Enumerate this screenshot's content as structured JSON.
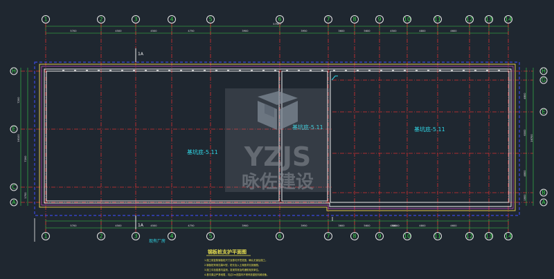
{
  "drawing": {
    "title": "钢板桩支护平面图",
    "place_label": "现有厂房",
    "section_top": "1A",
    "section_bottom": "1A",
    "level_left": "基坑底-5.11",
    "level_mid": "基坑底-5.11",
    "level_right": "基坑底-5.11",
    "total_top": "57950",
    "total_bottom": "38000",
    "notes": [
      "1.施工前复核钢板桩尺寸及基坑开挖范围，确认无误后施工。",
      "2.钢板桩采用拉森IV型，桩长及入土深度详见剖面图。",
      "3.施工中加强基坑监测，发现异常及时通知相关单位。",
      "4.基坑周边严禁堆载，坑边2m范围内不得停放重型机械设备。"
    ]
  },
  "axes_x": {
    "labels": [
      "1",
      "2",
      "3",
      "4",
      "5",
      "6",
      "7",
      "8",
      "9",
      "10",
      "11",
      "12",
      "13",
      "14"
    ],
    "spans_top": [
      "5700",
      "4500",
      "4500",
      "4750",
      "3900",
      "3950",
      "3600",
      "5600",
      "4500",
      "4800",
      "4600"
    ],
    "spans_bottom": [
      "5700",
      "4500",
      "4500",
      "4750",
      "3900",
      "3950",
      "3600",
      "5600",
      "4500",
      "4800",
      "4600"
    ]
  },
  "axes_y_left": {
    "labels": [
      "H",
      "E",
      "C",
      "A"
    ],
    "spans": [
      "7200",
      "7200",
      "1700"
    ],
    "total": "16100"
  },
  "axes_y_right": {
    "labels": [
      "H",
      "G",
      "E",
      "B",
      "A"
    ],
    "spans": [
      "4800",
      "6000",
      "4800",
      "1600"
    ],
    "total": "16700"
  },
  "watermark": {
    "brand": "YZJS",
    "subtitle": "咏佐建设"
  }
}
